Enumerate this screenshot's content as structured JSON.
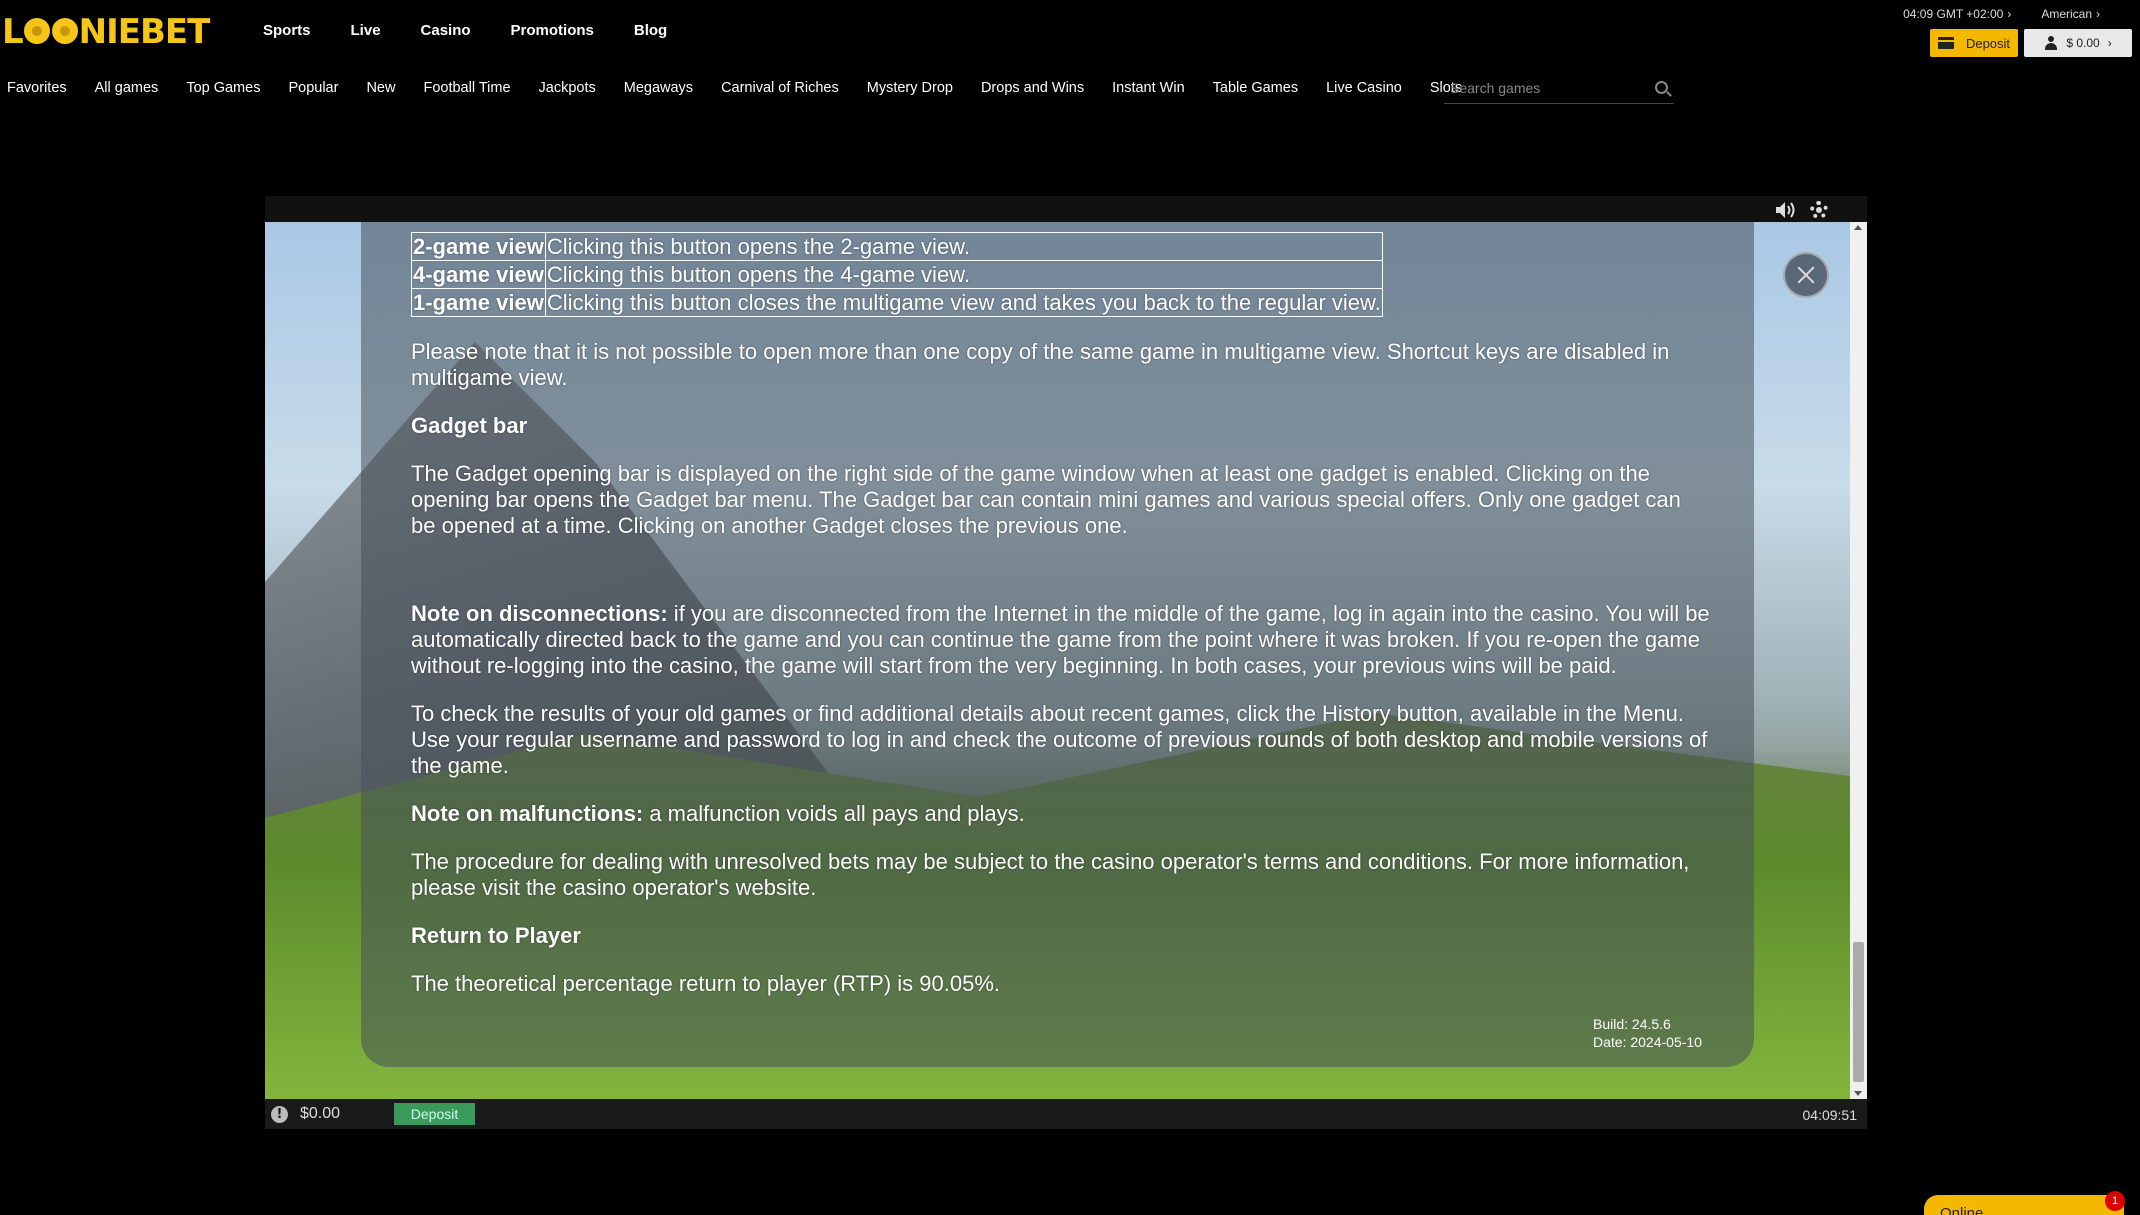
{
  "header": {
    "logo": "LOONIEBET",
    "nav": [
      "Sports",
      "Live",
      "Casino",
      "Promotions",
      "Blog"
    ],
    "clock": "04:09 GMT +02:00",
    "odds_format": "American",
    "deposit_label": "Deposit",
    "balance_label": "$ 0.00"
  },
  "categories": [
    "Favorites",
    "All games",
    "Top Games",
    "Popular",
    "New",
    "Football Time",
    "Jackpots",
    "Megaways",
    "Carnival of Riches",
    "Mystery Drop",
    "Drops and Wins",
    "Instant Win",
    "Table Games",
    "Live Casino",
    "Slots"
  ],
  "search": {
    "placeholder": "Search games"
  },
  "help": {
    "table": [
      {
        "key": "2-game view",
        "text": "Clicking this button opens the 2-game view."
      },
      {
        "key": "4-game view",
        "text": "Clicking this button opens the 4-game view."
      },
      {
        "key": "1-game view",
        "text": "Clicking this button closes the multigame view and takes you back to the regular view."
      }
    ],
    "p_multigame": "Please note that it is not possible to open more than one copy of the same game in multigame view. Shortcut keys are disabled in multigame view.",
    "h_gadget": "Gadget bar",
    "p_gadget": "The Gadget opening bar is displayed on the right side of the game window when at least one gadget is enabled. Clicking on the opening bar opens the Gadget bar menu. The Gadget bar can contain mini games and various special offers. Only one gadget can be opened at a time. Clicking on another Gadget closes the previous one.",
    "disconnect_label": "Note on disconnections:",
    "disconnect_text": " if you are disconnected from the Internet in the middle of the game, log in again into the casino. You will be automatically directed back to the game and you can continue the game from the point where it was broken. If you re-open the game without re-logging into the casino, the game will start from the very beginning. In both cases, your previous wins will be paid.",
    "p_history": "To check the results of your old games or find additional details about recent games, click the History button, available in the Menu. Use your regular username and password to log in and check the outcome of previous rounds of both desktop and mobile versions of the game.",
    "malfunction_label": "Note on malfunctions:",
    "malfunction_text": " a malfunction voids all pays and plays.",
    "p_procedure": "The procedure for dealing with unresolved bets may be subject to the casino operator's terms and conditions. For more information, please visit the casino operator's website.",
    "h_rtp": "Return to Player",
    "p_rtp": "The theoretical percentage return to player (RTP) is 90.05%.",
    "build": "Build: 24.5.6",
    "date": "Date: 2024-05-10"
  },
  "game_bar": {
    "balance": "$0.00",
    "deposit_label": "Deposit",
    "clock": "04:09:51"
  },
  "chat": {
    "label": "Online",
    "badge": "1"
  },
  "colors": {
    "accent": "#f5b800",
    "deposit_green": "#3a9a5a"
  }
}
